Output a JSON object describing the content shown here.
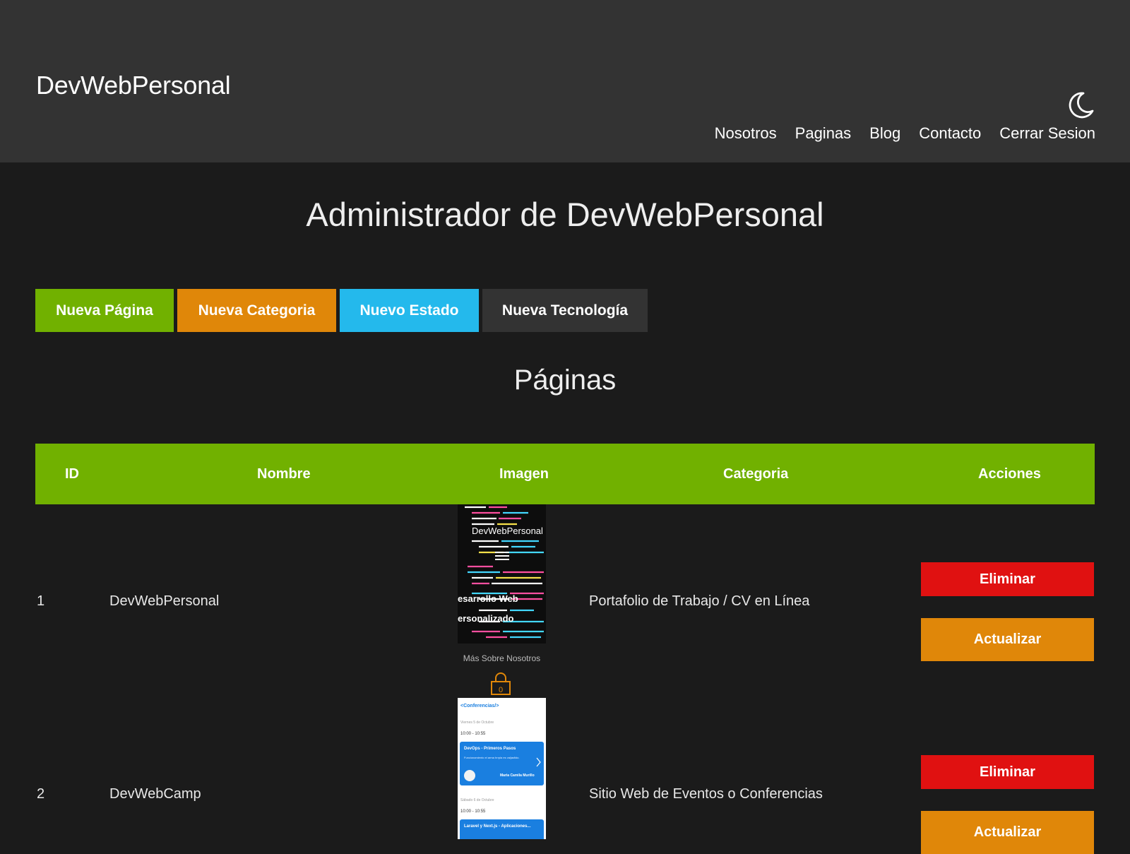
{
  "header": {
    "brand": "DevWebPersonal",
    "nav": [
      "Nosotros",
      "Paginas",
      "Blog",
      "Contacto",
      "Cerrar Sesion"
    ],
    "theme_icon": "moon-icon"
  },
  "main": {
    "title": "Administrador de DevWebPersonal",
    "buttons": {
      "nueva_pagina": "Nueva Página",
      "nueva_categoria": "Nueva Categoria",
      "nuevo_estado": "Nuevo Estado",
      "nueva_tecnologia": "Nueva Tecnología"
    },
    "section_title": "Páginas"
  },
  "table": {
    "columns": [
      "ID",
      "Nombre",
      "Imagen",
      "Categoria",
      "Acciones"
    ],
    "rows": [
      {
        "id": "1",
        "nombre": "DevWebPersonal",
        "categoria": "Portafolio de Trabajo / CV en Línea",
        "image_text": {
          "title": "DevWebPersonal",
          "line1": "esarrollo Web",
          "line2": "ersonalizado",
          "caption": "Más Sobre Nosotros",
          "lock_label": "0"
        }
      },
      {
        "id": "2",
        "nombre": "DevWebCamp",
        "categoria": "Sitio Web de Eventos o Conferencias",
        "image_text": {
          "heading": "<Conferencias/>",
          "day1": "Viernes 5 de Octubre",
          "time1": "10:00 - 10:55",
          "card1_title": "DevOps - Primeros Pasos",
          "card1_desc": "Funcionamiento el arma hrrpla es valjasfido.",
          "card1_speaker": "Maria Camila Murillo",
          "day2": "Sábado 6 de Octubre",
          "time2": "10:00 - 10:55",
          "card2_title": "Laravel y Next.js - Aplicaciones..."
        }
      }
    ],
    "actions": {
      "delete": "Eliminar",
      "update": "Actualizar"
    }
  },
  "colors": {
    "green": "#71b100",
    "orange": "#e08709",
    "blue": "#24b9ec",
    "red": "#e01111",
    "header_bg": "#333333",
    "page_bg": "#1b1b1b"
  }
}
